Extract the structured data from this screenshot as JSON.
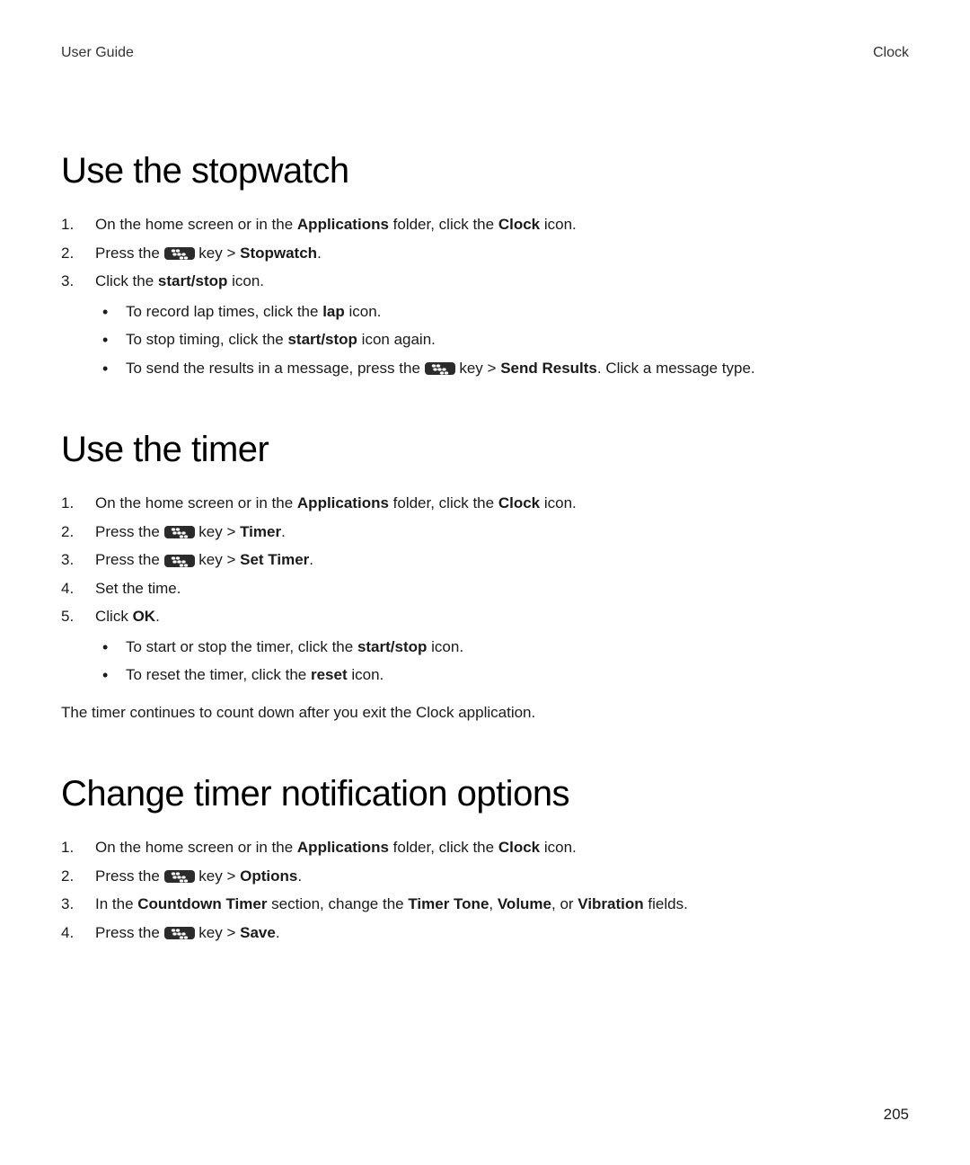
{
  "header": {
    "left": "User Guide",
    "right": "Clock"
  },
  "sections": {
    "stopwatch": {
      "heading": "Use the stopwatch",
      "step1_pre": "On the home screen or in the ",
      "step1_b1": "Applications",
      "step1_mid": " folder, click the ",
      "step1_b2": "Clock",
      "step1_post": " icon.",
      "step2_pre": "Press the ",
      "step2_mid": " key > ",
      "step2_b1": "Stopwatch",
      "step2_post": ".",
      "step3_pre": "Click the ",
      "step3_b1": "start/stop",
      "step3_post": " icon.",
      "bullet1_pre": "To record lap times, click the ",
      "bullet1_b1": "lap",
      "bullet1_post": " icon.",
      "bullet2_pre": "To stop timing, click the ",
      "bullet2_b1": "start/stop",
      "bullet2_post": " icon again.",
      "bullet3_pre": "To send the results in a message, press the ",
      "bullet3_mid": " key > ",
      "bullet3_b1": "Send Results",
      "bullet3_post": ". Click a message type."
    },
    "timer": {
      "heading": "Use the timer",
      "step1_pre": "On the home screen or in the ",
      "step1_b1": "Applications",
      "step1_mid": " folder, click the ",
      "step1_b2": "Clock",
      "step1_post": " icon.",
      "step2_pre": "Press the ",
      "step2_mid": " key > ",
      "step2_b1": "Timer",
      "step2_post": ".",
      "step3_pre": "Press the ",
      "step3_mid": " key > ",
      "step3_b1": "Set Timer",
      "step3_post": ".",
      "step4": "Set the time.",
      "step5_pre": "Click ",
      "step5_b1": "OK",
      "step5_post": ".",
      "bullet1_pre": "To start or stop the timer, click the ",
      "bullet1_b1": "start/stop",
      "bullet1_post": " icon.",
      "bullet2_pre": "To reset the timer, click the ",
      "bullet2_b1": "reset",
      "bullet2_post": " icon.",
      "footnote": "The timer continues to count down after you exit the Clock application."
    },
    "notif": {
      "heading": "Change timer notification options",
      "step1_pre": "On the home screen or in the ",
      "step1_b1": "Applications",
      "step1_mid": " folder, click the ",
      "step1_b2": "Clock",
      "step1_post": " icon.",
      "step2_pre": "Press the ",
      "step2_mid": " key > ",
      "step2_b1": "Options",
      "step2_post": ".",
      "step3_pre": "In the ",
      "step3_b1": "Countdown Timer",
      "step3_mid1": " section, change the ",
      "step3_b2": "Timer Tone",
      "step3_mid2": ", ",
      "step3_b3": "Volume",
      "step3_mid3": ", or ",
      "step3_b4": "Vibration",
      "step3_post": " fields.",
      "step4_pre": "Press the ",
      "step4_mid": " key > ",
      "step4_b1": "Save",
      "step4_post": "."
    }
  },
  "page_number": "205"
}
